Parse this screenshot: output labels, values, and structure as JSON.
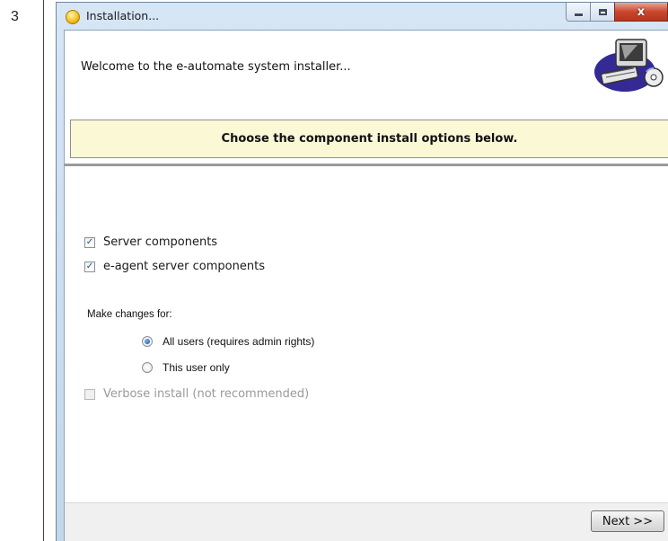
{
  "step": {
    "number": "3"
  },
  "window": {
    "title": "Installation...",
    "controls": {
      "close_label": "x"
    }
  },
  "header": {
    "welcome": "Welcome to the e-automate system installer...",
    "art_icon": "computer-cd-icon"
  },
  "banner": {
    "text": "Choose the component install options below."
  },
  "components": [
    {
      "label": "Server components",
      "checked": true,
      "enabled": true
    },
    {
      "label": "e-agent server components",
      "checked": true,
      "enabled": true
    }
  ],
  "scope": {
    "label": "Make changes for:",
    "options": [
      {
        "label": "All users (requires admin rights)",
        "selected": true
      },
      {
        "label": "This user only",
        "selected": false
      }
    ]
  },
  "verbose": {
    "label": "Verbose install (not recommended)",
    "checked": false,
    "enabled": false
  },
  "footer": {
    "next_label": "Next >>"
  },
  "colors": {
    "banner": "#fbf8d6",
    "close_button": "#c9472f",
    "window_frame": "#c3d6ea"
  }
}
